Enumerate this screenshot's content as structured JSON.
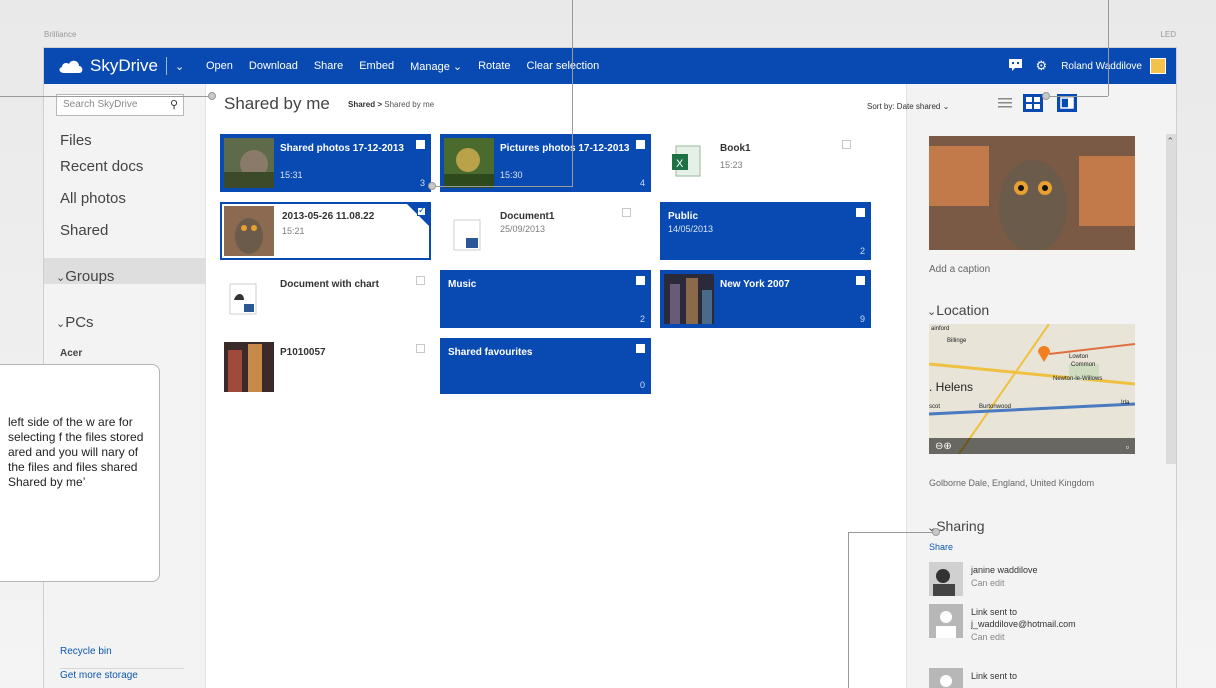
{
  "bezel": {
    "brand": "Brilliance",
    "led": "LED"
  },
  "app": {
    "name": "SkyDrive"
  },
  "commands": [
    "Open",
    "Download",
    "Share",
    "Embed",
    "Manage ⌄",
    "Rotate",
    "Clear selection"
  ],
  "user": {
    "name": "Roland Waddilove"
  },
  "search": {
    "placeholder": "Search SkyDrive"
  },
  "nav": {
    "files": "Files",
    "recent": "Recent docs",
    "photos": "All photos",
    "shared": "Shared",
    "groups": "Groups",
    "pcs": "PCs",
    "pc_acer": "Acer",
    "recycle": "Recycle bin",
    "storage": "Get more storage"
  },
  "page": {
    "title": "Shared by me",
    "breadcrumb_root": "Shared",
    "breadcrumb_sep": ">",
    "breadcrumb_current": "Shared by me"
  },
  "tiles": [
    {
      "title": "Shared photos 17-12-2013",
      "date": "15:31",
      "count": "3"
    },
    {
      "title": "Pictures photos 17-12-2013",
      "date": "15:30",
      "count": "4"
    },
    {
      "title": "Book1",
      "date": "15:23"
    },
    {
      "title": "2013-05-26 11.08.22",
      "date": "15:21"
    },
    {
      "title": "Document1",
      "date": "25/09/2013"
    },
    {
      "title": "Public",
      "date": "14/05/2013",
      "count": "2"
    },
    {
      "title": "Document with chart"
    },
    {
      "title": "Music",
      "count": "2"
    },
    {
      "title": "New York 2007",
      "count": "9"
    },
    {
      "title": "P1010057"
    },
    {
      "title": "Shared favourites",
      "count": "0"
    }
  ],
  "details": {
    "sort_label": "Sort by: Date shared ⌄",
    "caption": "Add a caption",
    "location_heading": "Location",
    "location_text": "Golborne Dale, England, United Kingdom",
    "sharing_heading": "Sharing",
    "share_link": "Share",
    "map_labels": [
      "ainford",
      "Billinge",
      "Lowton",
      "Common",
      "Newton-le-Willows",
      ". Helens",
      "scot",
      "Burtonwood",
      "Irla"
    ],
    "people": [
      {
        "name": "janine waddilove",
        "role": "Can edit"
      },
      {
        "name": "Link sent to j_waddilove@hotmail.com",
        "role": "Can edit"
      },
      {
        "name": "Link sent to"
      }
    ]
  },
  "annotation": {
    "text": "left side of the w are for selecting f the files stored ared and you will nary of the files and files shared Shared by me’"
  },
  "colors": {
    "accent": "#094ab2",
    "link": "#0a58b0"
  }
}
